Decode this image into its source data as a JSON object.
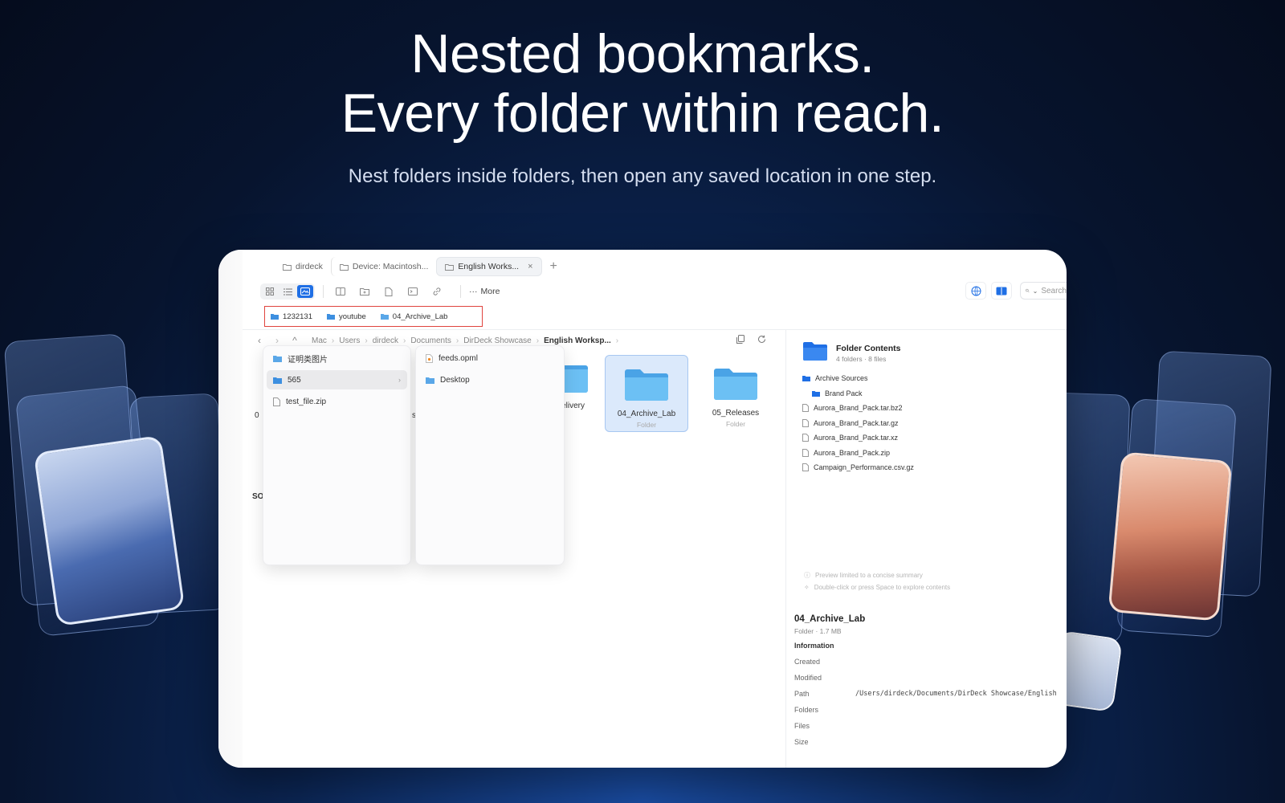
{
  "hero": {
    "headline_1": "Nested bookmarks.",
    "headline_2": "Every folder within reach.",
    "subline": "Nest folders inside folders, then open any saved location in one step."
  },
  "tabs": [
    {
      "label": "dirdeck"
    },
    {
      "label": "Device: Macintosh..."
    },
    {
      "label": "English Works...",
      "close": "×"
    }
  ],
  "tab_add": "+",
  "toolbar": {
    "more_label": "More",
    "search_placeholder": "Search"
  },
  "bookmarks": [
    {
      "label": "1232131"
    },
    {
      "label": "youtube"
    },
    {
      "label": "04_Archive_Lab"
    }
  ],
  "breadcrumb": [
    "Mac",
    "Users",
    "dirdeck",
    "Documents",
    "DirDeck Showcase",
    "English Worksp..."
  ],
  "grid": {
    "partial_left_1": "0",
    "partial_left_2": "s",
    "partial_left_3": "SO",
    "partial_delivery": "elivery",
    "items": [
      {
        "name": "04_Archive_Lab",
        "kind": "Folder",
        "selected": true
      },
      {
        "name": "05_Releases",
        "kind": "Folder",
        "selected": false
      }
    ]
  },
  "popup_1": [
    {
      "label": "证明类图片",
      "icon": "folder-icon"
    },
    {
      "label": "565",
      "icon": "folder-icon",
      "has_children": true
    },
    {
      "label": "test_file.zip",
      "icon": "file-icon"
    }
  ],
  "popup_2": [
    {
      "label": "feeds.opml",
      "icon": "rss-file-icon"
    },
    {
      "label": "Desktop",
      "icon": "folder-icon"
    }
  ],
  "preview": {
    "title": "Folder Contents",
    "subtitle": "4 folders · 8 files",
    "tree": [
      {
        "label": "Archive Sources",
        "type": "folder"
      },
      {
        "label": "Brand Pack",
        "type": "folder",
        "indent": true
      },
      {
        "label": "Aurora_Brand_Pack.tar.bz2",
        "type": "file"
      },
      {
        "label": "Aurora_Brand_Pack.tar.gz",
        "type": "file"
      },
      {
        "label": "Aurora_Brand_Pack.tar.xz",
        "type": "file"
      },
      {
        "label": "Aurora_Brand_Pack.zip",
        "type": "file"
      },
      {
        "label": "Campaign_Performance.csv.gz",
        "type": "file"
      }
    ],
    "hint_1": "Preview limited to a concise summary",
    "hint_2": "Double-click or press Space to explore contents",
    "name": "04_Archive_Lab",
    "meta": "Folder · 1.7 MB",
    "info_heading": "Information",
    "info": [
      {
        "label": "Created",
        "value": ""
      },
      {
        "label": "Modified",
        "value": ""
      },
      {
        "label": "Path",
        "value": "/Users/dirdeck/Documents/DirDeck Showcase/English"
      },
      {
        "label": "Folders",
        "value": ""
      },
      {
        "label": "Files",
        "value": ""
      },
      {
        "label": "Size",
        "value": ""
      }
    ]
  },
  "colors": {
    "accent": "#1f6fe5",
    "folder_blue": "#5bb4ee",
    "bookmark_highlight": "#e0443e"
  }
}
